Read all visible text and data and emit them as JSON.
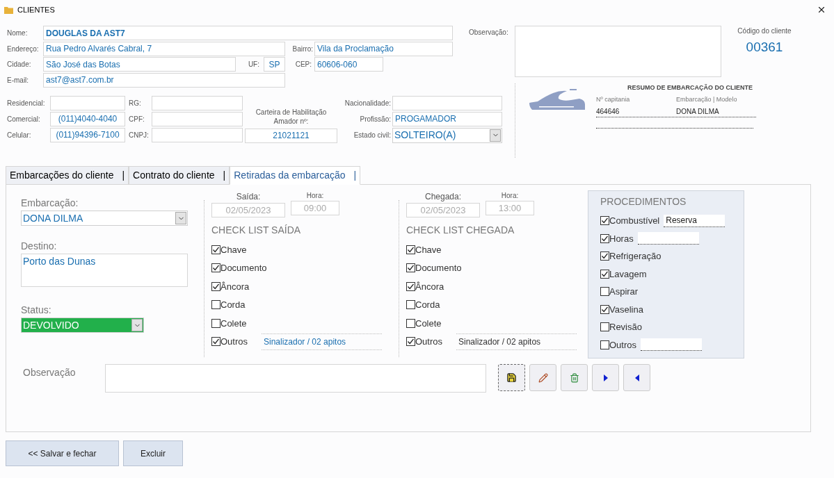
{
  "window": {
    "title": "CLIENTES"
  },
  "address": {
    "name": {
      "label": "Nome:",
      "value": "DOUGLAS DA AST7"
    },
    "street": {
      "label": "Endereço:",
      "value": "Rua Pedro Alvarés Cabral, 7"
    },
    "district": {
      "label": "Bairro:",
      "value": "Vila da Proclamação"
    },
    "city": {
      "label": "Cidade:",
      "value": "São José das Botas"
    },
    "state": {
      "label": "UF:",
      "value": "SP"
    },
    "zip": {
      "label": "CEP:",
      "value": "60606-060"
    },
    "email": {
      "label": "E-mail:",
      "value": "ast7@ast7.com.br"
    }
  },
  "documents": {
    "phones": [
      {
        "label": "Residencial:"
      },
      {
        "label": "Comercial:",
        "value": "(011)4040-4040"
      },
      {
        "label": "Celular:",
        "value": "(011)94396-7100"
      }
    ],
    "ids": [
      {
        "label": "RG:"
      },
      {
        "label": "CPF:"
      },
      {
        "label": "CNPJ:"
      }
    ],
    "license": {
      "label": "Carteira de Habilitação Amador nº:",
      "value": "21021121"
    },
    "personal": [
      {
        "label": "Nacionalidade:",
        "kind": "text"
      },
      {
        "label": "Profissão:",
        "value": "PROGAMADOR",
        "kind": "text"
      },
      {
        "label": "Estado civil:",
        "value": "SOLTEIRO(A)",
        "kind": "select"
      }
    ]
  },
  "observation": {
    "label": "Observação:"
  },
  "client_code": {
    "label": "Código do cliente",
    "value": "00361"
  },
  "summary": {
    "title": "RESUMO DE EMBARCAÇÃO DO CLIENTE",
    "columns": [
      {
        "label": "Nº capitania",
        "value": "464646"
      },
      {
        "label": "Embarcação | Modelo",
        "value": "DONA DILMA"
      }
    ]
  },
  "tabs": [
    {
      "label": "Embarcações do cliente",
      "separator": "|",
      "selected": false
    },
    {
      "label": "Contrato do cliente",
      "separator": "|",
      "selected": false
    },
    {
      "label": "Retiradas da embarcação",
      "separator": "|",
      "selected": true
    }
  ],
  "withdrawal": {
    "vessel": {
      "label": "Embarcação:",
      "value": "DONA DILMA"
    },
    "destination": {
      "label": "Destino:",
      "value": "Porto das Dunas"
    },
    "status": {
      "label": "Status:",
      "value": "DEVOLVIDO",
      "color": "#22b04b"
    }
  },
  "departure": {
    "date_label": "Saída:",
    "date": "02/05/2023",
    "time_label": "Hora:",
    "time": "09:00",
    "disabled": true,
    "title": "CHECK LIST SAÍDA",
    "items": [
      {
        "label": "Chave",
        "checked": true
      },
      {
        "label": "Documento",
        "checked": true
      },
      {
        "label": "Âncora",
        "checked": true
      },
      {
        "label": "Corda",
        "checked": false
      },
      {
        "label": "Colete",
        "checked": false
      },
      {
        "label": "Outros",
        "checked": true,
        "kind": "link",
        "note": "Sinalizador / 02 apitos"
      }
    ]
  },
  "arrival": {
    "date_label": "Chegada:",
    "date": "02/05/2023",
    "time_label": "Hora:",
    "time": "13:00",
    "disabled": true,
    "title": "CHECK LIST CHEGADA",
    "items": [
      {
        "label": "Chave",
        "checked": true
      },
      {
        "label": "Documento",
        "checked": true
      },
      {
        "label": "Âncora",
        "checked": true
      },
      {
        "label": "Corda",
        "checked": false
      },
      {
        "label": "Colete",
        "checked": false
      },
      {
        "label": "Outros",
        "checked": true,
        "kind": "note",
        "note": "Sinalizador / 02 apitos"
      }
    ]
  },
  "procedures": {
    "title": "PROCEDIMENTOS",
    "items": [
      {
        "label": "Combustível",
        "checked": true,
        "kind": "field",
        "value": "Reserva"
      },
      {
        "label": "Horas",
        "checked": true,
        "kind": "field"
      },
      {
        "label": "Refrigeração",
        "checked": true,
        "kind": "plain"
      },
      {
        "label": "Lavagem",
        "checked": true,
        "kind": "plain"
      },
      {
        "label": "Aspirar",
        "checked": false,
        "kind": "plain"
      },
      {
        "label": "Vaselina",
        "checked": true,
        "kind": "plain"
      },
      {
        "label": "Revisão",
        "checked": false,
        "kind": "plain"
      },
      {
        "label": "Outros",
        "checked": false,
        "kind": "field"
      }
    ]
  },
  "notes": {
    "label": "Observação"
  },
  "toolbar": [
    {
      "kind": "save"
    },
    {
      "kind": "edit"
    },
    {
      "kind": "delete"
    },
    {
      "kind": "next"
    },
    {
      "kind": "previous"
    }
  ],
  "actions": [
    {
      "label": "<< Salvar e fechar"
    },
    {
      "label": "Excluir"
    }
  ]
}
